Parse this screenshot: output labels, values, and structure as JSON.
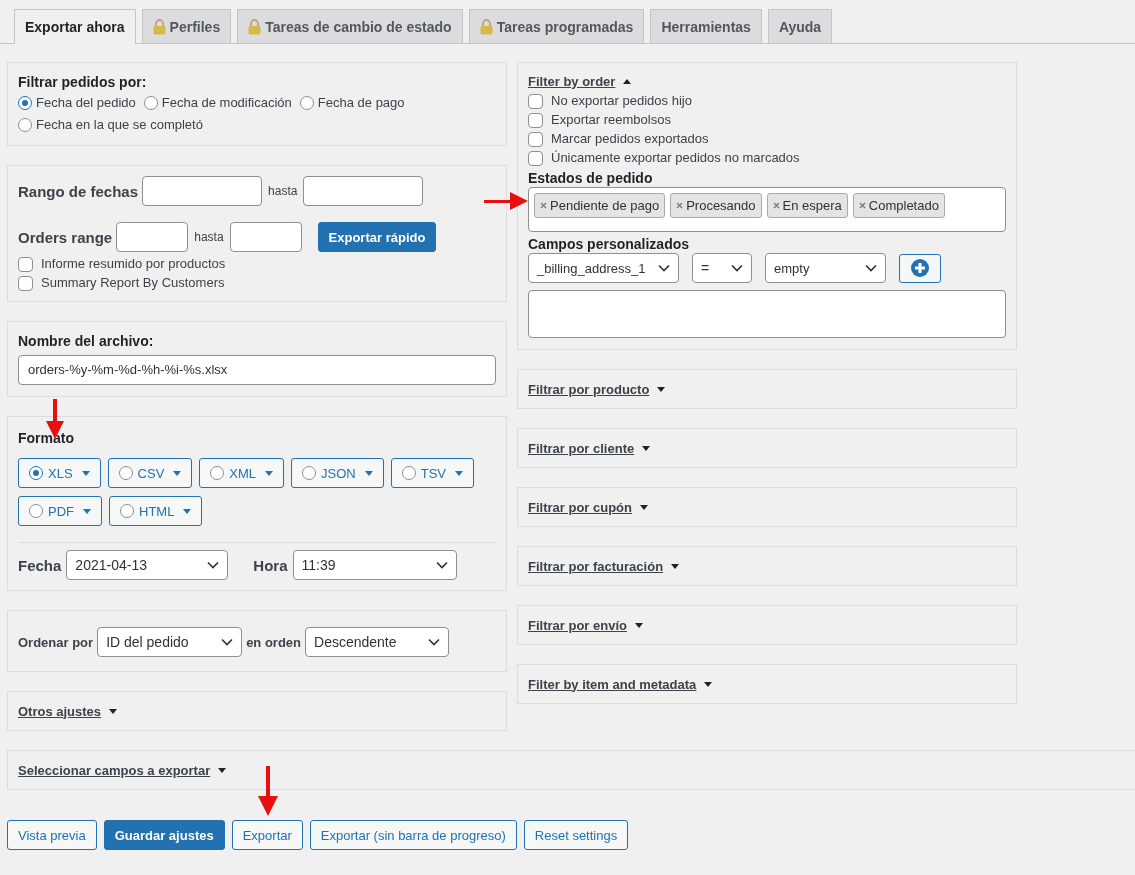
{
  "tabs": [
    {
      "label": "Exportar ahora",
      "locked": false,
      "selected": true
    },
    {
      "label": "Perfiles",
      "locked": true,
      "selected": false
    },
    {
      "label": "Tareas de cambio de estado",
      "locked": true,
      "selected": false
    },
    {
      "label": "Tareas programadas",
      "locked": true,
      "selected": false
    },
    {
      "label": "Herramientas",
      "locked": false,
      "selected": false
    },
    {
      "label": "Ayuda",
      "locked": false,
      "selected": false
    }
  ],
  "filter_by_date": {
    "title": "Filtrar pedidos por:",
    "options": [
      {
        "label": "Fecha del pedido",
        "selected": true
      },
      {
        "label": "Fecha de modificación",
        "selected": false
      },
      {
        "label": "Fecha de pago",
        "selected": false
      },
      {
        "label": "Fecha en la que se completó",
        "selected": false
      }
    ]
  },
  "ranges": {
    "date_label": "Rango de fechas",
    "date_to": "hasta",
    "orders_label": "Orders range",
    "orders_to": "hasta",
    "quick_export": "Exportar rápido",
    "checkboxes": [
      {
        "label": "Informe resumido por productos",
        "checked": false
      },
      {
        "label": "Summary Report By Customers",
        "checked": false
      }
    ]
  },
  "filename": {
    "label": "Nombre del archivo:",
    "value": "orders-%y-%m-%d-%h-%i-%s.xlsx"
  },
  "format": {
    "title": "Formato",
    "options": [
      {
        "label": "XLS",
        "selected": true
      },
      {
        "label": "CSV",
        "selected": false
      },
      {
        "label": "XML",
        "selected": false
      },
      {
        "label": "JSON",
        "selected": false
      },
      {
        "label": "TSV",
        "selected": false
      },
      {
        "label": "PDF",
        "selected": false
      },
      {
        "label": "HTML",
        "selected": false
      }
    ],
    "date_label": "Fecha",
    "date_value": "2021-04-13",
    "time_label": "Hora",
    "time_value": "11:39"
  },
  "sort": {
    "label": "Ordenar por",
    "value": "ID del pedido",
    "order_label": "en orden",
    "order_value": "Descendente"
  },
  "other_settings": {
    "title": "Otros ajustes",
    "expanded": false
  },
  "filter_by_order": {
    "title": "Filter by order",
    "expanded": true,
    "checkboxes": [
      {
        "label": "No exportar pedidos hijo",
        "checked": false
      },
      {
        "label": "Exportar reembolsos",
        "checked": false
      },
      {
        "label": "Marcar pedidos exportados",
        "checked": false
      },
      {
        "label": "Únicamente exportar pedidos no marcados",
        "checked": false
      }
    ],
    "statuses_label": "Estados de pedido",
    "statuses": [
      "Pendiente de pago",
      "Procesando",
      "En espera",
      "Completado"
    ],
    "custom_fields_label": "Campos personalizados",
    "field": "_billing_address_1",
    "operator": "=",
    "value": "empty"
  },
  "filter_panels": [
    {
      "title": "Filtrar por producto",
      "expanded": false
    },
    {
      "title": "Filtrar por cliente",
      "expanded": false
    },
    {
      "title": "Filtrar por cupón",
      "expanded": false
    },
    {
      "title": "Filtrar por facturación",
      "expanded": false
    },
    {
      "title": "Filtrar por envío",
      "expanded": false
    },
    {
      "title": "Filter by item and metadata",
      "expanded": false
    }
  ],
  "select_fields": {
    "title": "Seleccionar campos a exportar",
    "expanded": false
  },
  "buttons": [
    {
      "label": "Vista previa",
      "primary": false
    },
    {
      "label": "Guardar ajustes",
      "primary": true
    },
    {
      "label": "Exportar",
      "primary": false
    },
    {
      "label": "Exportar (sin barra de progreso)",
      "primary": false
    },
    {
      "label": "Reset settings",
      "primary": false
    }
  ]
}
